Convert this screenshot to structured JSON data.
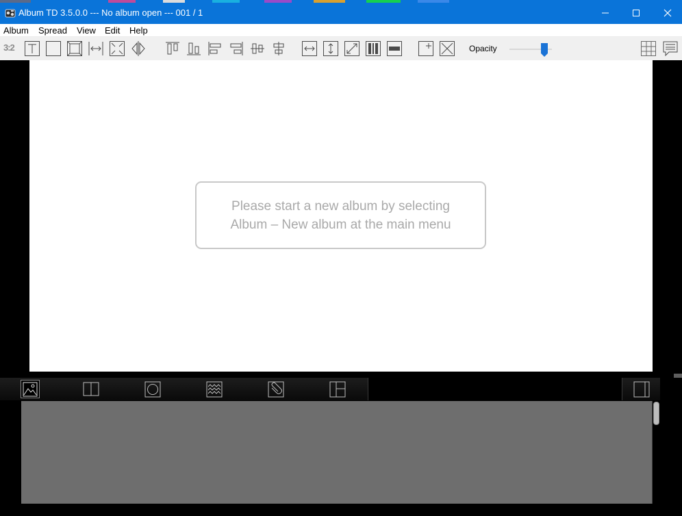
{
  "window": {
    "title": "Album TD 3.5.0.0 --- No album open --- 001 / 1",
    "accent_color": "#0a74d9",
    "controls": [
      {
        "name": "minimize",
        "icon": "minimize-icon"
      },
      {
        "name": "maximize",
        "icon": "maximize-icon"
      },
      {
        "name": "close",
        "icon": "close-icon"
      }
    ]
  },
  "menubar": {
    "items": [
      "Album",
      "Spread",
      "View",
      "Edit",
      "Help"
    ]
  },
  "toolbar": {
    "aspect_label": "3:2",
    "opacity_label": "Opacity",
    "opacity_value": 0.88,
    "icons": [
      "text-box-icon",
      "blank-frame-icon",
      "photo-frame-icon",
      "fit-width-icon",
      "shrink-icon",
      "flip-icon",
      "align-top-icon",
      "align-bottom-icon",
      "align-left-icon",
      "align-right-icon",
      "center-vertical-icon",
      "center-horizontal-icon",
      "stretch-horizontal-icon",
      "stretch-vertical-icon",
      "stretch-diagonal-icon",
      "vertical-bars-icon",
      "horizontal-bar-icon",
      "add-icon",
      "delete-icon",
      "grid-icon",
      "notes-icon"
    ]
  },
  "canvas": {
    "hint_line1": "Please start a new album by selecting",
    "hint_line2": "Album – New album at the main menu"
  },
  "bottom_panel": {
    "tabs": [
      {
        "icon": "image-icon",
        "active": true
      },
      {
        "icon": "book-icon",
        "active": false
      },
      {
        "icon": "circle-frame-icon",
        "active": false
      },
      {
        "icon": "background-pattern-icon",
        "active": false
      },
      {
        "icon": "clip-icon",
        "active": false
      },
      {
        "icon": "layout-icon",
        "active": false
      }
    ],
    "right_tab_icon": "single-page-icon"
  }
}
